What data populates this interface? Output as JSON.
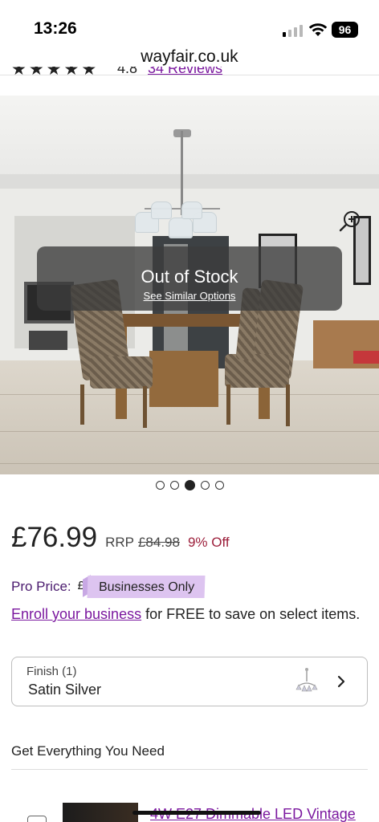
{
  "status_bar": {
    "time": "13:26",
    "battery": "96"
  },
  "browser": {
    "url": "wayfair.co.uk"
  },
  "rating": {
    "value": "4.8",
    "reviews_label": "34 Reviews"
  },
  "hero": {
    "overlay_title": "Out of Stock",
    "overlay_link": "See Similar Options",
    "slides_total": 5,
    "active_slide": 3
  },
  "pricing": {
    "price": "£76.99",
    "rrp_label": "RRP",
    "rrp_value": "£84.98",
    "discount": "9% Off"
  },
  "pro": {
    "label": "Pro Price:",
    "pound": "£",
    "badge": "Businesses Only"
  },
  "enroll": {
    "link": "Enroll your business",
    "text": " for FREE to save on select items."
  },
  "finish": {
    "label": "Finish (1)",
    "value": "Satin Silver"
  },
  "recommendations": {
    "title": "Get Everything You Need",
    "items": [
      {
        "title": "4W E27 Dimmable LED Vintage"
      }
    ]
  },
  "colors": {
    "brand_purple": "#7b189f",
    "discount_red": "#9c1e3a",
    "pro_badge_bg": "#ddc4f0"
  }
}
